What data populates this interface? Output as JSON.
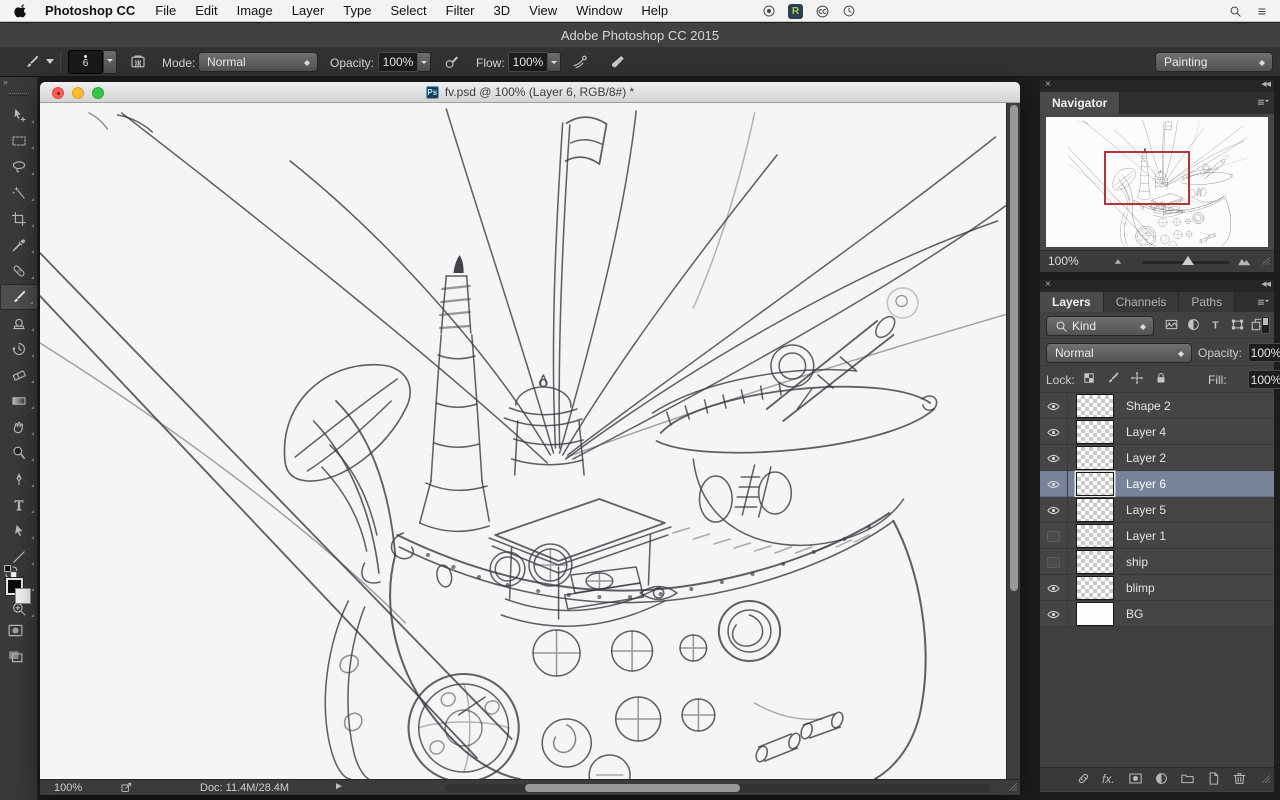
{
  "menubar": {
    "app_name": "Photoshop CC",
    "items": [
      "File",
      "Edit",
      "Image",
      "Layer",
      "Type",
      "Select",
      "Filter",
      "3D",
      "View",
      "Window",
      "Help"
    ],
    "r_badge_letter": "R"
  },
  "app_titlebar": {
    "title": "Adobe Photoshop CC 2015"
  },
  "options_bar": {
    "brush_size": "6",
    "mode_label": "Mode:",
    "mode_value": "Normal",
    "opacity_label": "Opacity:",
    "opacity_value": "100%",
    "flow_label": "Flow:",
    "flow_value": "100%",
    "workspace_value": "Painting"
  },
  "toolbar": {
    "tools": [
      "move",
      "marquee",
      "lasso",
      "magic-wand",
      "crop",
      "eyedropper",
      "healing-brush",
      "brush",
      "clone-stamp",
      "history-brush",
      "eraser",
      "gradient",
      "smudge",
      "dodge",
      "pen",
      "type",
      "path-select",
      "line",
      "hand",
      "zoom"
    ],
    "selected": "brush"
  },
  "document_window": {
    "title": "fv.psd @ 100% (Layer 6, RGB/8#) *",
    "file_icon_text": "Ps",
    "status_zoom": "100%",
    "status_doc": "Doc: 11.4M/28.4M"
  },
  "navigator": {
    "tab": "Navigator",
    "zoom": "100%"
  },
  "layers_panel": {
    "tabs": [
      "Layers",
      "Channels",
      "Paths"
    ],
    "filter_value": "Kind",
    "blend_value": "Normal",
    "opacity_label": "Opacity:",
    "opacity_value": "100%",
    "lock_label": "Lock:",
    "fill_label": "Fill:",
    "fill_value": "100%",
    "rows": [
      {
        "name": "Shape 2",
        "visible": true,
        "selected": false,
        "thumb": "checker"
      },
      {
        "name": "Layer 4",
        "visible": true,
        "selected": false,
        "thumb": "checker"
      },
      {
        "name": "Layer 2",
        "visible": true,
        "selected": false,
        "thumb": "checker"
      },
      {
        "name": "Layer 6",
        "visible": true,
        "selected": true,
        "thumb": "checker"
      },
      {
        "name": "Layer 5",
        "visible": true,
        "selected": false,
        "thumb": "checker"
      },
      {
        "name": "Layer 1",
        "visible": false,
        "selected": false,
        "thumb": "checker"
      },
      {
        "name": "ship",
        "visible": false,
        "selected": false,
        "thumb": "checker"
      },
      {
        "name": "blimp",
        "visible": true,
        "selected": false,
        "thumb": "checker"
      },
      {
        "name": "BG",
        "visible": true,
        "selected": false,
        "thumb": "white"
      }
    ]
  },
  "colors": {
    "selection_blue": "#76839b",
    "navigator_proxy_red": "#b5323c",
    "r_badge_green": "#9fd14a"
  }
}
